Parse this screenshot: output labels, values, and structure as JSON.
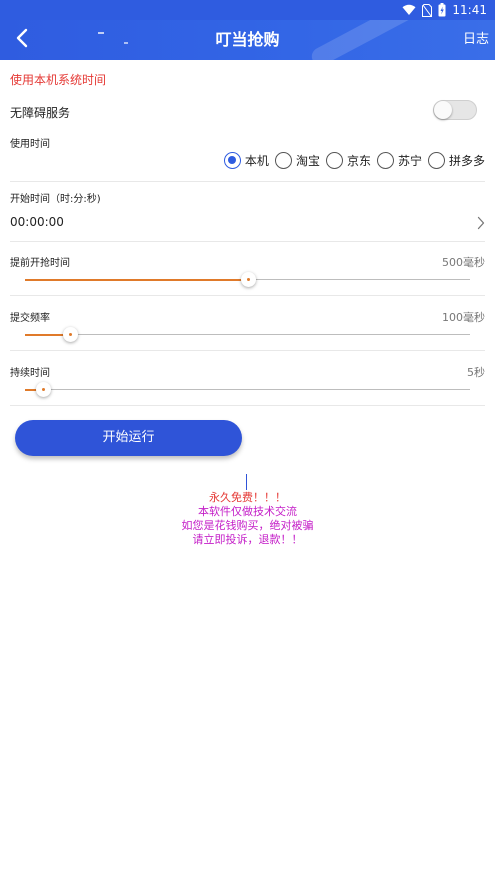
{
  "status_bar": {
    "time": "11:41",
    "icons": [
      "wifi-icon",
      "sim-no-signal-icon",
      "battery-charging-icon"
    ]
  },
  "app_bar": {
    "title": "叮当抢购",
    "back_icon": "back-arrow-icon",
    "log_label": "日志",
    "color": "#2f5ce0"
  },
  "settings": {
    "system_time_link": "使用本机系统时间",
    "accessibility": {
      "label": "无障碍服务",
      "enabled": false
    },
    "time_source": {
      "label": "使用时间",
      "options": [
        "本机",
        "淘宝",
        "京东",
        "苏宁",
        "拼多多"
      ],
      "selected": "本机"
    },
    "start_time": {
      "label": "开始时间（时:分:秒)",
      "value": "00:00:00",
      "chevron_icon": "chevron-right-icon"
    },
    "advance": {
      "label": "提前开抢时间",
      "value_text": "500毫秒",
      "fraction": 0.5
    },
    "frequency": {
      "label": "提交频率",
      "value_text": "100毫秒",
      "fraction": 0.1
    },
    "duration": {
      "label": "持续时间",
      "value_text": "5秒",
      "fraction": 0.04
    }
  },
  "actions": {
    "start_label": "开始运行"
  },
  "notice": {
    "line1": "永久免费！！！",
    "line2": "本软件仅做技术交流",
    "line3": "如您是花钱购买，绝对被骗",
    "line4": "请立即投诉，退款！！"
  },
  "colors": {
    "accent": "#2f5ce0",
    "warning_red": "#e53935",
    "notice_magenta": "#c41ec8",
    "slider_fill": "#e07a2a"
  }
}
